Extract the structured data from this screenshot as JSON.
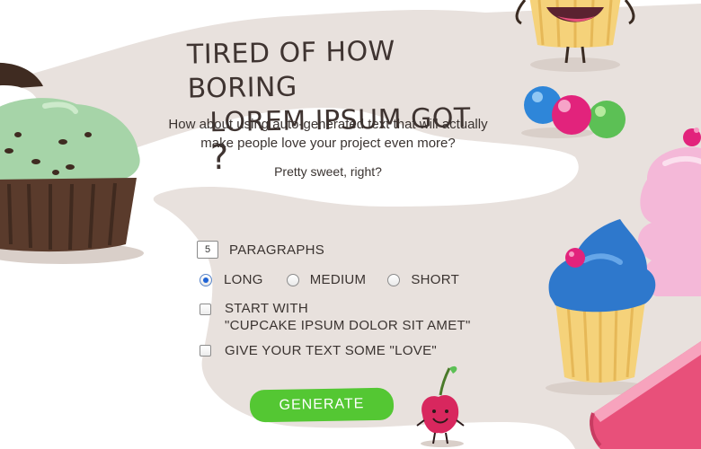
{
  "headline": {
    "line1": "TIRED OF HOW BORING",
    "line2": "LOREM IPSUM GOT",
    "mark": "?"
  },
  "subtitle": {
    "line1": "How about using auto-generated text that will actually",
    "line2": "make people love your project even more?"
  },
  "tagline": "Pretty sweet, right?",
  "form": {
    "paragraphs": {
      "value": "5",
      "label": "PARAGRAPHS"
    },
    "length_options": [
      {
        "label": "LONG",
        "selected": true
      },
      {
        "label": "MEDIUM",
        "selected": false
      },
      {
        "label": "SHORT",
        "selected": false
      }
    ],
    "start_with": {
      "line1": "START WITH",
      "line2": "\"CUPCAKE IPSUM DOLOR SIT AMET\"",
      "checked": false
    },
    "love": {
      "label": "GIVE YOUR TEXT SOME \"LOVE\"",
      "checked": false
    },
    "generate_label": "GENERATE"
  },
  "colors": {
    "background": "#ffffff",
    "blob": "#e8e1dd",
    "text": "#3a3330",
    "button": "#54c733",
    "radio_selected": "#1e63d6"
  }
}
